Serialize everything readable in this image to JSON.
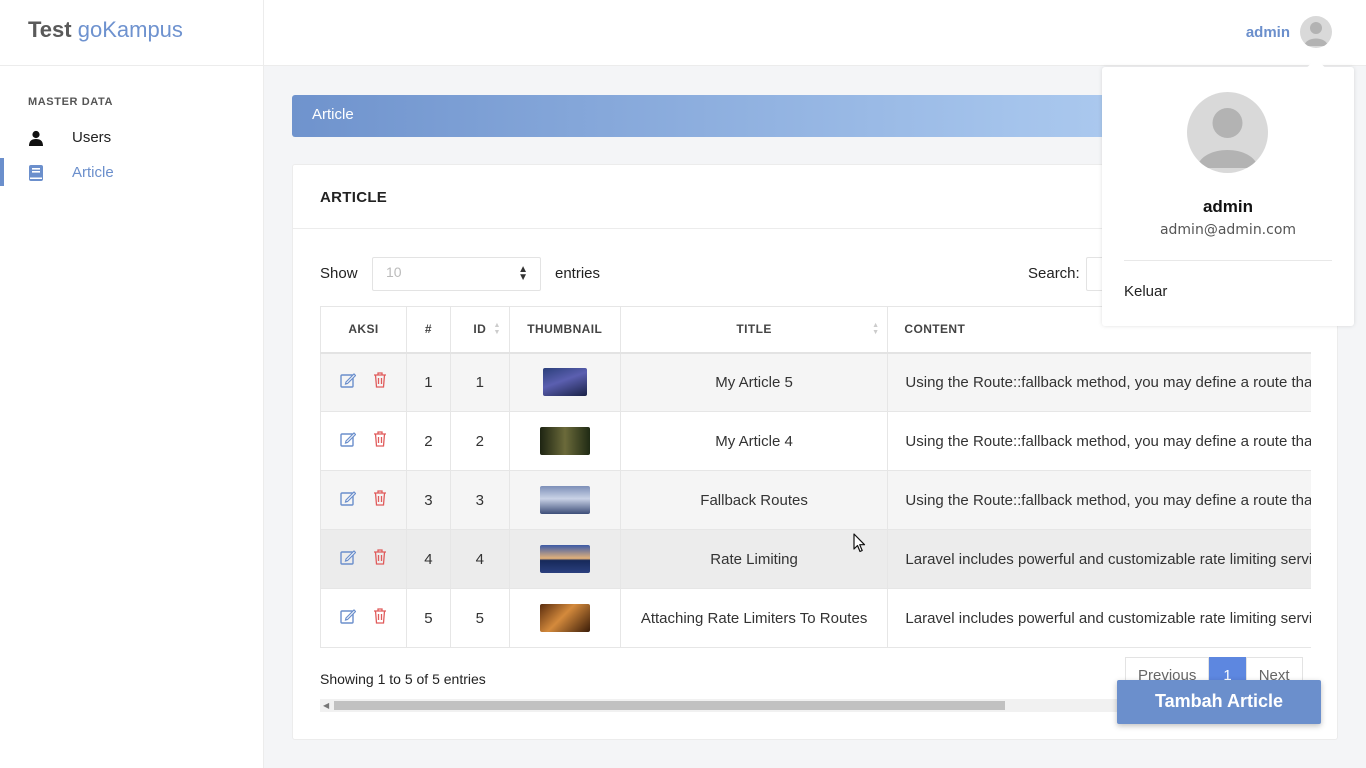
{
  "brand": {
    "part1": "Test",
    "part2": "goKampus"
  },
  "sidebar": {
    "section": "MASTER DATA",
    "items": [
      {
        "label": "Users",
        "icon": "user-icon",
        "active": false
      },
      {
        "label": "Article",
        "icon": "book-icon",
        "active": true
      }
    ]
  },
  "topbar": {
    "username": "admin"
  },
  "banner": {
    "title": "Article"
  },
  "card": {
    "title": "ARTICLE",
    "show_label": "Show",
    "page_length": "10",
    "entries_label": "entries",
    "search_label": "Search:"
  },
  "table": {
    "headers": [
      "AKSI",
      "#",
      "ID",
      "THUMBNAIL",
      "TITLE",
      "CONTENT"
    ],
    "rows": [
      {
        "no": "1",
        "id": "1",
        "title": "My Article 5",
        "content": "Using the Route::fallback method, you may define a route that",
        "thumb": "night-mountain"
      },
      {
        "no": "2",
        "id": "2",
        "title": "My Article 4",
        "content": "Using the Route::fallback method, you may define a route that",
        "thumb": "forest-waterfall"
      },
      {
        "no": "3",
        "id": "3",
        "title": "Fallback Routes",
        "content": "Using the Route::fallback method, you may define a route that",
        "thumb": "winter-forest"
      },
      {
        "no": "4",
        "id": "4",
        "title": "Rate Limiting",
        "content": "Laravel includes powerful and customizable rate limiting services",
        "thumb": "lake-sunset"
      },
      {
        "no": "5",
        "id": "5",
        "title": "Attaching Rate Limiters To Routes",
        "content": "Laravel includes powerful and customizable rate limiting services",
        "thumb": "cafe-chair"
      }
    ]
  },
  "footer": {
    "info": "Showing 1 to 5 of 5 entries",
    "prev": "Previous",
    "page": "1",
    "next": "Next"
  },
  "fab": {
    "label": "Tambah Article"
  },
  "dropdown": {
    "name": "admin",
    "email": "admin@admin.com",
    "logout": "Keluar"
  },
  "colors": {
    "accent": "#6b8fcc",
    "danger": "#e05b5b",
    "page_active": "#5d87e0"
  }
}
